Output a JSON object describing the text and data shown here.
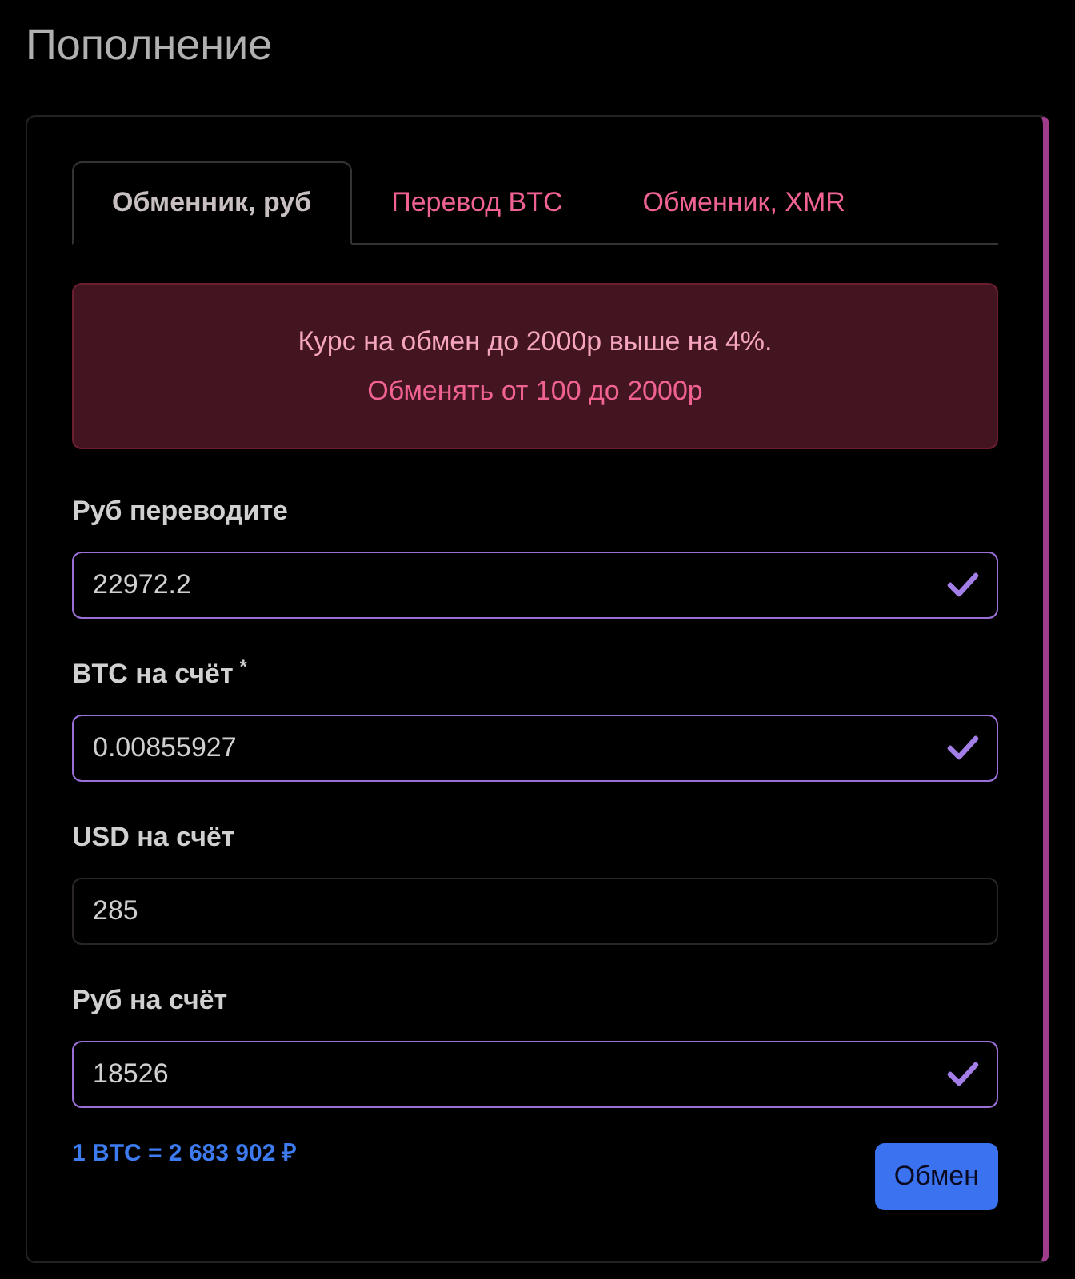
{
  "page_title": "Пополнение",
  "tabs": [
    {
      "label": "Обменник, руб",
      "selected": true
    },
    {
      "label": "Перевод BTC",
      "selected": false
    },
    {
      "label": "Обменник, XMR",
      "selected": false
    }
  ],
  "alert": {
    "lines": [
      "Курс на обмен до 2000р выше на 4%.",
      "Обменять от 100 до 2000р"
    ]
  },
  "fields": [
    {
      "label": "Руб переводите",
      "required": false,
      "value": "22972.2",
      "validated": true
    },
    {
      "label": "BTC на счёт",
      "required": true,
      "value": "0.00855927",
      "validated": true
    },
    {
      "label": "USD на счёт",
      "required": false,
      "value": "285",
      "validated": false
    },
    {
      "label": "Руб на счёт",
      "required": false,
      "value": "18526",
      "validated": true
    }
  ],
  "required_mark": "*",
  "rate": "1 BTC = 2 683 902 ₽",
  "submit_button": "Обмен"
}
